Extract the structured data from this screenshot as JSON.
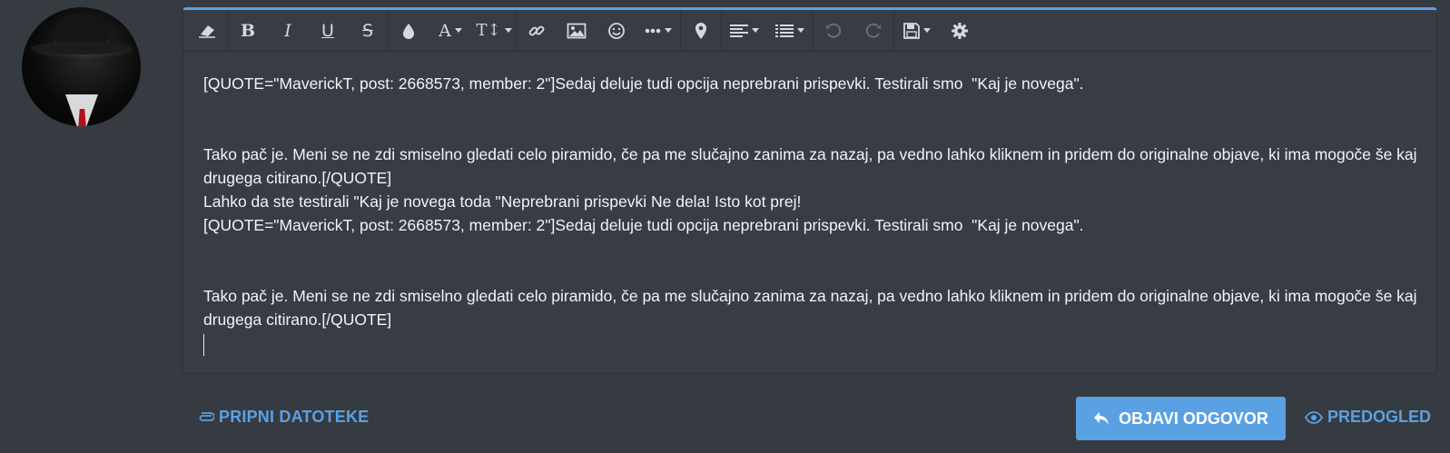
{
  "toolbar": {
    "buttons": [
      {
        "name": "remove-formatting",
        "icon": "eraser-icon"
      },
      {
        "name": "bold",
        "glyph": "B"
      },
      {
        "name": "italic",
        "glyph": "I"
      },
      {
        "name": "underline",
        "glyph": "U"
      },
      {
        "name": "strikethrough",
        "glyph": "S"
      },
      {
        "name": "text-color",
        "icon": "droplet-icon"
      },
      {
        "name": "font-family",
        "glyph": "A"
      },
      {
        "name": "font-size",
        "glyph": "T↕"
      },
      {
        "name": "insert-link",
        "icon": "link-icon"
      },
      {
        "name": "insert-image",
        "icon": "image-icon"
      },
      {
        "name": "insert-smilie",
        "icon": "smiley-icon"
      },
      {
        "name": "more-options",
        "icon": "ellipsis-icon"
      },
      {
        "name": "insert-media",
        "icon": "map-pin-icon"
      },
      {
        "name": "align",
        "icon": "align-left-icon"
      },
      {
        "name": "list",
        "icon": "list-icon"
      },
      {
        "name": "undo",
        "icon": "undo-icon"
      },
      {
        "name": "redo",
        "icon": "redo-icon"
      },
      {
        "name": "drafts",
        "icon": "save-icon"
      },
      {
        "name": "toggle-bbcode",
        "icon": "gear-icon"
      }
    ],
    "labels": {
      "bold": "B",
      "italic": "I",
      "underline": "U",
      "strike": "S",
      "font": "A",
      "size": "T↕"
    }
  },
  "editor": {
    "lines": [
      "[QUOTE=\"MaverickT, post: 2668573, member: 2\"]Sedaj deluje tudi opcija neprebrani prispevki. Testirali smo  \"Kaj je novega\".",
      "Tako pač je. Meni se ne zdi smiselno gledati celo piramido, če pa me slučajno zanima za nazaj, pa vedno lahko kliknem in pridem do originalne objave, ki ima mogoče še kaj drugega citirano.[/QUOTE]",
      "Lahko da ste testirali \"Kaj je novega toda \"Neprebrani prispevki Ne dela! Isto kot prej!",
      "[QUOTE=\"MaverickT, post: 2668573, member: 2\"]Sedaj deluje tudi opcija neprebrani prispevki. Testirali smo  \"Kaj je novega\".",
      "Tako pač je. Meni se ne zdi smiselno gledati celo piramido, če pa me slučajno zanima za nazaj, pa vedno lahko kliknem in pridem do originalne objave, ki ima mogoče še kaj drugega citirano.[/QUOTE]"
    ]
  },
  "footer": {
    "attach_label": "PRIPNI DATOTEKE",
    "post_label": "OBJAVI ODGOVOR",
    "preview_label": "PREDOGLED"
  },
  "colors": {
    "accent": "#5aa1e3",
    "background": "#363a41",
    "editor_bg": "#383c44",
    "text": "#f2f3f5"
  }
}
